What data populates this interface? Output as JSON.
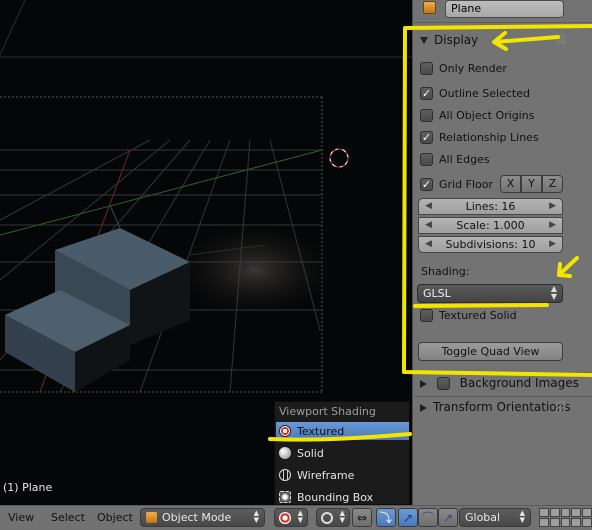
{
  "viewport": {
    "object_label": "(1) Plane"
  },
  "header": {
    "menus": [
      "View",
      "Select",
      "Object"
    ],
    "mode": "Object Mode",
    "orientation": "Global"
  },
  "panel": {
    "object_name": "Plane",
    "display_section": "Display",
    "checkboxes": [
      {
        "label": "Only Render",
        "checked": false
      },
      {
        "label": "Outline Selected",
        "checked": true
      },
      {
        "label": "All Object Origins",
        "checked": false
      },
      {
        "label": "Relationship Lines",
        "checked": true
      },
      {
        "label": "All Edges",
        "checked": false
      }
    ],
    "grid_floor": {
      "label": "Grid Floor",
      "checked": true,
      "axes": [
        "X",
        "Y",
        "Z"
      ]
    },
    "lines": "Lines: 16",
    "scale": "Scale: 1.000",
    "subdivisions": "Subdivisions: 10",
    "shading_label": "Shading:",
    "shading_value": "GLSL",
    "textured_solid": {
      "label": "Textured Solid",
      "checked": false
    },
    "toggle_quad": "Toggle Quad View",
    "background_images": "Background Images",
    "transform_orientations": "Transform Orientations"
  },
  "shade_menu": {
    "title": "Viewport Shading",
    "options": [
      {
        "label": "Textured",
        "active": true
      },
      {
        "label": "Solid",
        "active": false
      },
      {
        "label": "Wireframe",
        "active": false
      },
      {
        "label": "Bounding Box",
        "active": false
      }
    ]
  },
  "colors": {
    "annotation": "#f3e500",
    "menu_highlight": "#5b88c8",
    "panel_bg": "#737373"
  }
}
